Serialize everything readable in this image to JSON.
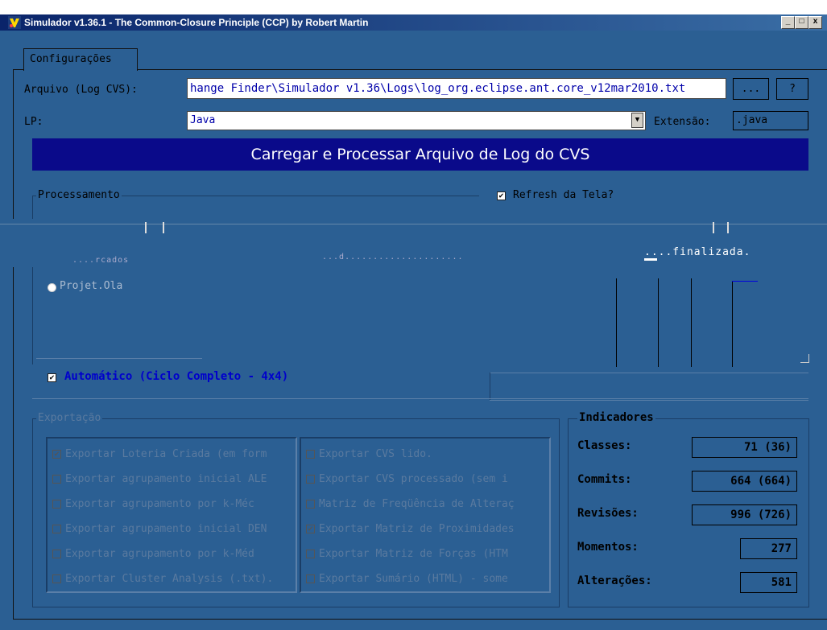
{
  "window": {
    "title": "Simulador v1.36.1 - The Common-Closure Principle (CCP) by Robert Martin",
    "minimize": "_",
    "maximize": "□",
    "close": "x"
  },
  "tabs": [
    {
      "label": "Configurações"
    }
  ],
  "config": {
    "file_label": "Arquivo (Log CVS):",
    "file_value": "hange Finder\\Simulador v1.36\\Logs\\log_org.eclipse.ant.core_v12mar2010.txt",
    "browse_label": "...",
    "help_label": "?",
    "lp_label": "LP:",
    "lp_value": "Java",
    "ext_label": "Extensão:",
    "ext_value": ".java"
  },
  "process_button": "Carregar e Processar Arquivo de Log do CVS",
  "processamento": {
    "title": "Processamento",
    "refresh_label": "Refresh da Tela?",
    "refresh_checked": true,
    "automatic_label": "Automático (Ciclo Completo - 4x4)",
    "automatic_checked": true,
    "radio_label": "Projet.Ola",
    "glitch_text_1": "....rcados",
    "glitch_text_2": "...d.....................",
    "glitch_text_3": "....finalizada."
  },
  "exportacao": {
    "title": "Exportação",
    "left_items": [
      {
        "label": "Exportar Loteria Criada (em form",
        "checked": true
      },
      {
        "label": "Exportar agrupamento inicial ALE",
        "checked": false
      },
      {
        "label": "Exportar agrupamento por k-Méc",
        "checked": false
      },
      {
        "label": "Exportar agrupamento inicial DEN",
        "checked": false
      },
      {
        "label": "Exportar agrupamento por k-Méd",
        "checked": false
      },
      {
        "label": "Exportar Cluster Analysis (.txt).",
        "checked": false
      }
    ],
    "right_items": [
      {
        "label": "Exportar CVS lido.",
        "checked": false
      },
      {
        "label": "Exportar CVS processado (sem i",
        "checked": false
      },
      {
        "label": "Matriz de Freqüência de Alteraç",
        "checked": false
      },
      {
        "label": "Exportar Matriz de Proximidades",
        "checked": true
      },
      {
        "label": "Exportar Matriz de Forças (HTM",
        "checked": false
      },
      {
        "label": "Exportar Sumário (HTML) - some",
        "checked": false
      }
    ]
  },
  "indicadores": {
    "title": "Indicadores",
    "rows": [
      {
        "label": "Classes:",
        "value": "71 (36)"
      },
      {
        "label": "Commits:",
        "value": "664 (664)"
      },
      {
        "label": "Revisões:",
        "value": "996 (726)"
      },
      {
        "label": "Momentos:",
        "value": "277"
      },
      {
        "label": "Alterações:",
        "value": "581"
      }
    ]
  },
  "colors": {
    "background": "#2b5f93",
    "title_bar": "#0a246a",
    "process_button": "#0a0a8a",
    "accent_text": "#0000cc"
  }
}
